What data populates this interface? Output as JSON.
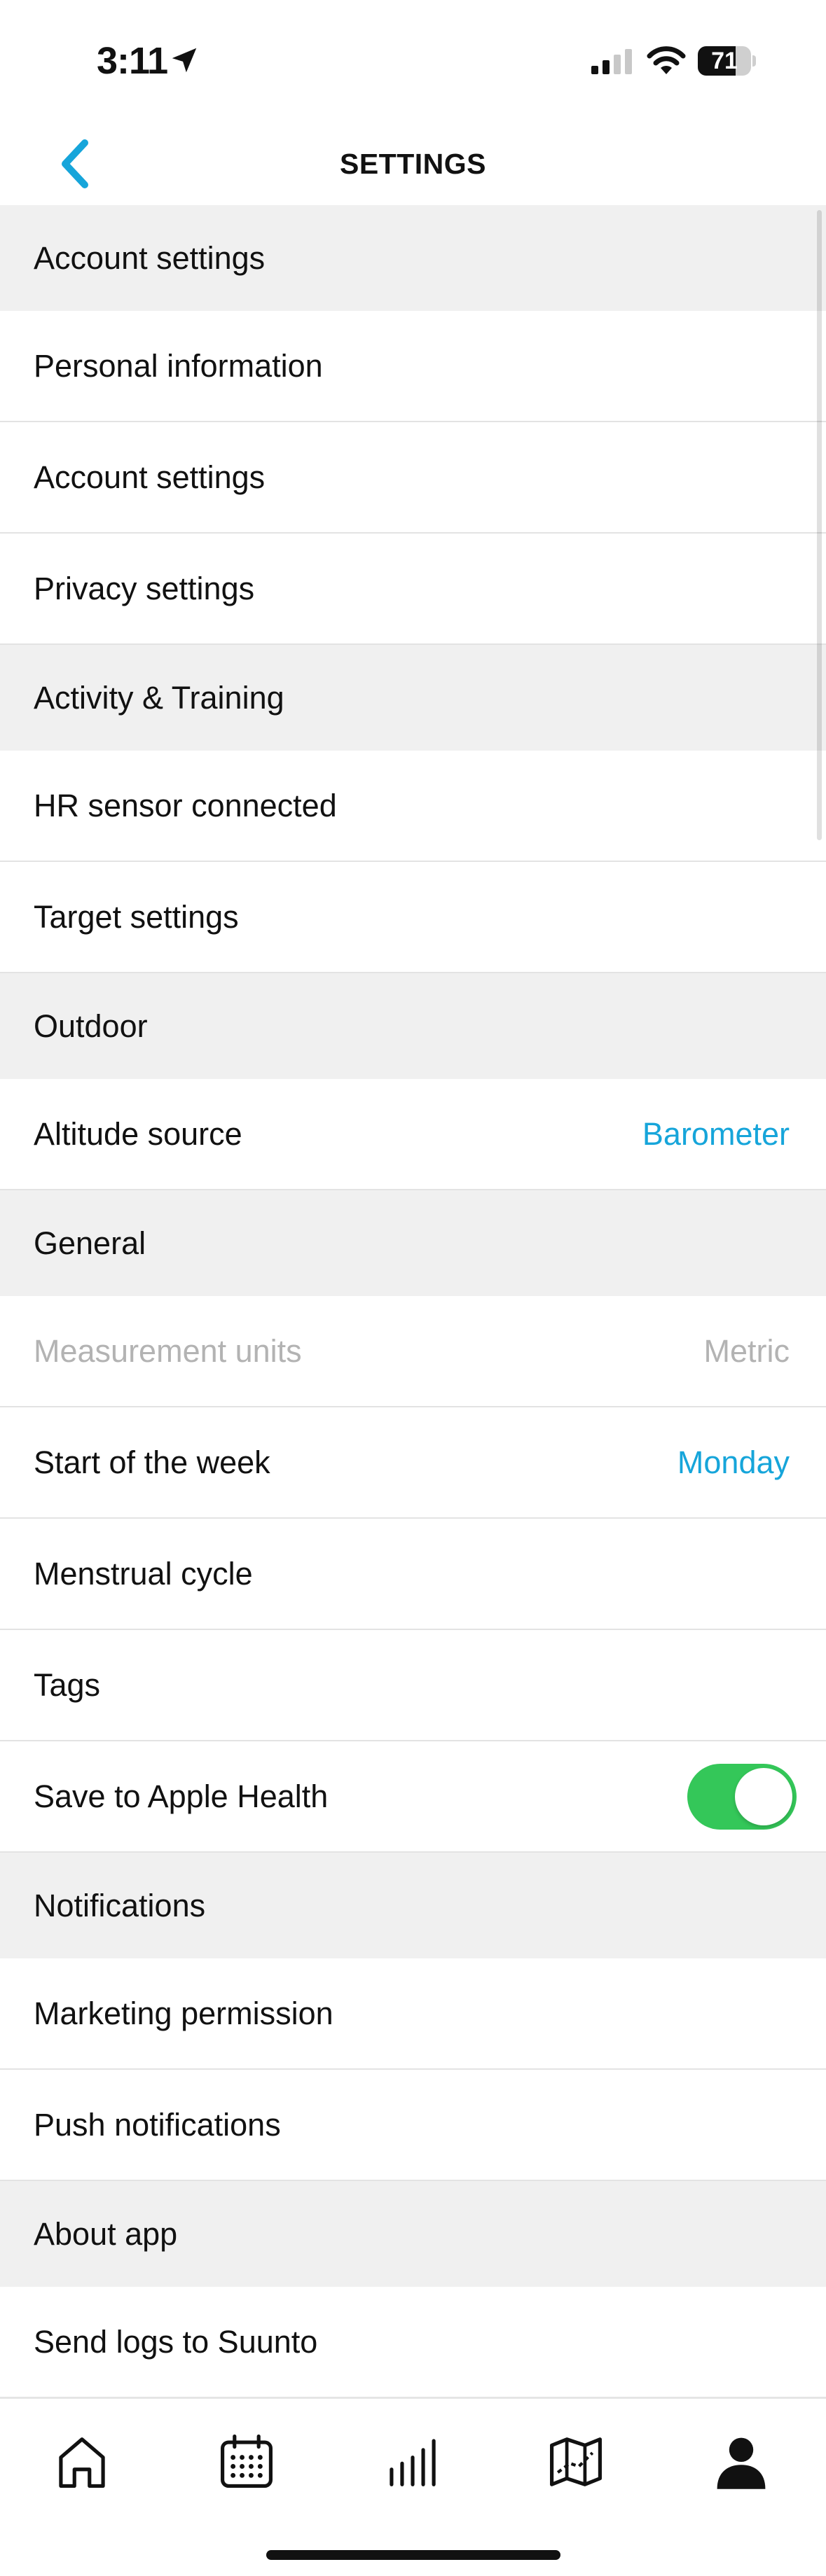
{
  "status_bar": {
    "time": "3:11",
    "battery_level": "71",
    "battery_fraction": 0.71,
    "icons": [
      "location-arrow-icon",
      "cellular-signal-icon",
      "wifi-icon",
      "battery-icon"
    ]
  },
  "header": {
    "title": "SETTINGS",
    "back_icon": "chevron-left-icon"
  },
  "colors": {
    "accent": "#16a5da",
    "toggle_on": "#34c759",
    "section_bg": "#f0f0f0",
    "disabled_text": "#b3b3b3"
  },
  "settings": {
    "account_section": "Account settings",
    "personal_information": "Personal information",
    "account_settings": "Account settings",
    "privacy_settings": "Privacy settings",
    "activity_section": "Activity & Training",
    "hr_sensor": "HR sensor connected",
    "target_settings": "Target settings",
    "outdoor_section": "Outdoor",
    "altitude_source": {
      "label": "Altitude source",
      "value": "Barometer"
    },
    "general_section": "General",
    "measurement_units": {
      "label": "Measurement units",
      "value": "Metric"
    },
    "start_of_week": {
      "label": "Start of the week",
      "value": "Monday"
    },
    "menstrual_cycle": "Menstrual cycle",
    "tags": "Tags",
    "save_to_apple_health": {
      "label": "Save to Apple Health",
      "enabled": true
    },
    "notifications_section": "Notifications",
    "marketing_permission": "Marketing permission",
    "push_notifications": "Push notifications",
    "about_section": "About app",
    "send_logs": "Send logs to Suunto"
  },
  "tab_bar": {
    "tabs": [
      "home-icon",
      "calendar-icon",
      "diary-bars-icon",
      "map-icon",
      "profile-icon"
    ],
    "active": "profile-icon"
  }
}
